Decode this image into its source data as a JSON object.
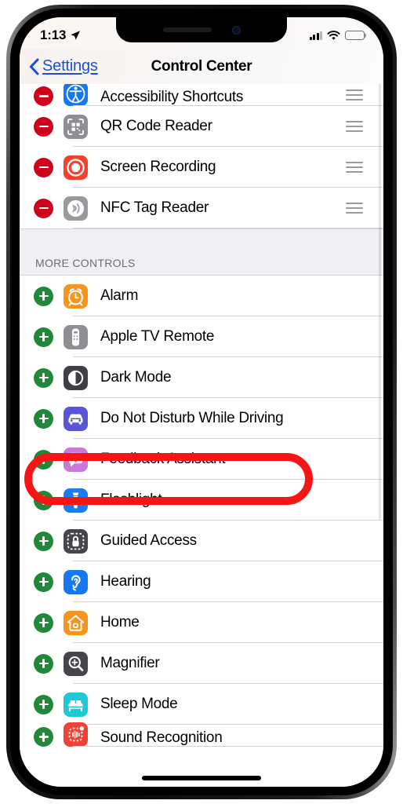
{
  "status_bar": {
    "time": "1:13",
    "location_icon": "location-arrow-icon",
    "signal_icon": "cellular-signal-icon",
    "wifi_icon": "wifi-icon",
    "battery_icon": "battery-icon"
  },
  "nav": {
    "back_label": "Settings",
    "back_icon": "chevron-left-icon",
    "title": "Control Center"
  },
  "included_controls": {
    "rows": [
      {
        "label": "Accessibility Shortcuts",
        "action": "remove",
        "icon": "accessibility-icon",
        "icon_color": "#1677f2",
        "clipped": true
      },
      {
        "label": "QR Code Reader",
        "action": "remove",
        "icon": "qr-code-icon",
        "icon_color": "#8e8e93"
      },
      {
        "label": "Screen Recording",
        "action": "remove",
        "icon": "screen-recording-icon",
        "icon_color": "#f8402f"
      },
      {
        "label": "NFC Tag Reader",
        "action": "remove",
        "icon": "nfc-icon",
        "icon_color": "#9a9a9e"
      }
    ]
  },
  "more_controls": {
    "header": "MORE CONTROLS",
    "rows": [
      {
        "label": "Alarm",
        "action": "add",
        "icon": "alarm-clock-icon",
        "icon_color": "#f7941e"
      },
      {
        "label": "Apple TV Remote",
        "action": "add",
        "icon": "tv-remote-icon",
        "icon_color": "#8e8e93"
      },
      {
        "label": "Dark Mode",
        "action": "add",
        "icon": "dark-mode-icon",
        "icon_color": "#3f3f44"
      },
      {
        "label": "Do Not Disturb While Driving",
        "action": "add",
        "icon": "car-icon",
        "icon_color": "#5a54d6"
      },
      {
        "label": "Feedback Assistant",
        "action": "add",
        "icon": "feedback-assistant-icon",
        "icon_color": "#cb79d8"
      },
      {
        "label": "Flashlight",
        "action": "add",
        "icon": "flashlight-icon",
        "icon_color": "#1b7bf2",
        "highlighted": true
      },
      {
        "label": "Guided Access",
        "action": "add",
        "icon": "guided-access-lock-icon",
        "icon_color": "#45454a"
      },
      {
        "label": "Hearing",
        "action": "add",
        "icon": "hearing-ear-icon",
        "icon_color": "#1677f2"
      },
      {
        "label": "Home",
        "action": "add",
        "icon": "home-house-icon",
        "icon_color": "#f7941e"
      },
      {
        "label": "Magnifier",
        "action": "add",
        "icon": "magnifier-icon",
        "icon_color": "#45454a"
      },
      {
        "label": "Sleep Mode",
        "action": "add",
        "icon": "sleep-bed-icon",
        "icon_color": "#20c7d4"
      },
      {
        "label": "Sound Recognition",
        "action": "add",
        "icon": "sound-recognition-icon",
        "icon_color": "#ef4136",
        "clipped": true
      }
    ]
  },
  "annotation": {
    "target_label": "Flashlight",
    "shape": "ellipse",
    "color": "#f71414"
  },
  "colors": {
    "remove_badge": "#d0021b",
    "add_badge": "#218739",
    "link": "#1c4fd8",
    "section_bg": "#efeff4",
    "separator": "#d4d4d6"
  }
}
